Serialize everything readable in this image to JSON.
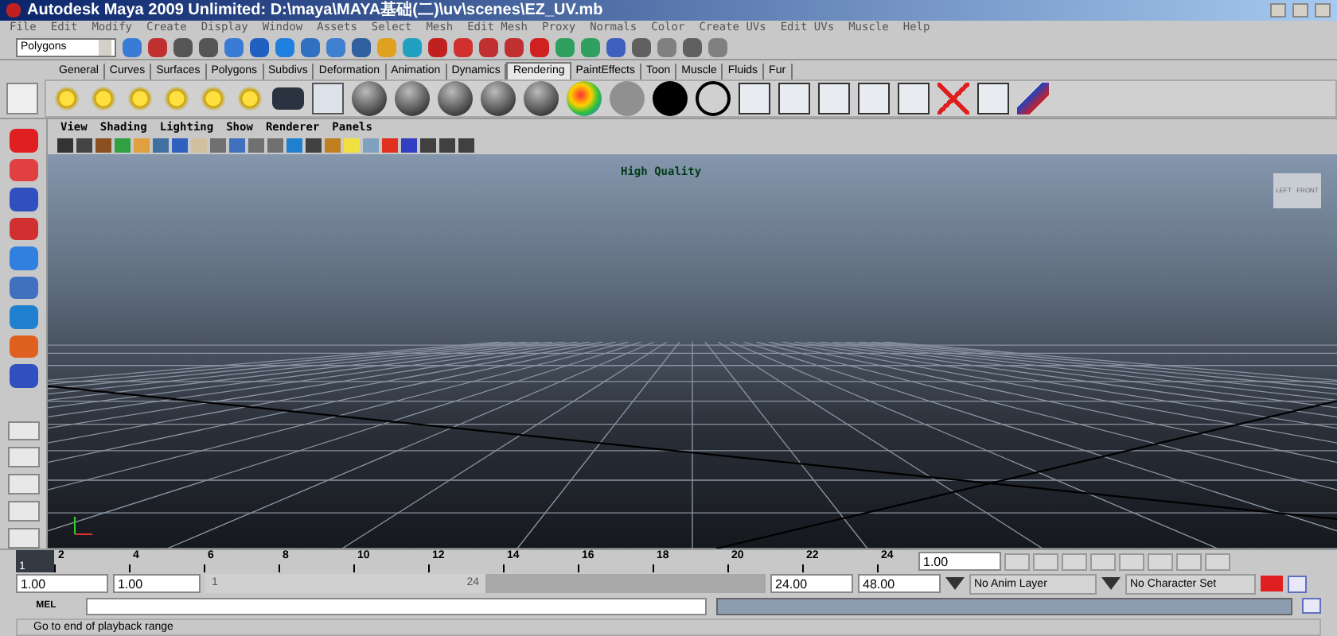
{
  "window": {
    "title": "Autodesk Maya 2009 Unlimited: D:\\maya\\MAYA基础(二)\\uv\\scenes\\EZ_UV.mb"
  },
  "menu": [
    "File",
    "Edit",
    "Modify",
    "Create",
    "Display",
    "Window",
    "Assets",
    "Select",
    "Mesh",
    "Edit Mesh",
    "Proxy",
    "Normals",
    "Color",
    "Create UVs",
    "Edit UVs",
    "Muscle",
    "Help"
  ],
  "status_line": {
    "mode": "Polygons"
  },
  "shelf_tabs": [
    {
      "label": "General",
      "selected": false
    },
    {
      "label": "Curves",
      "selected": false
    },
    {
      "label": "Surfaces",
      "selected": false
    },
    {
      "label": "Polygons",
      "selected": false
    },
    {
      "label": "Subdivs",
      "selected": false
    },
    {
      "label": "Deformation",
      "selected": false
    },
    {
      "label": "Animation",
      "selected": false
    },
    {
      "label": "Dynamics",
      "selected": false
    },
    {
      "label": "Rendering",
      "selected": true
    },
    {
      "label": "PaintEffects",
      "selected": false
    },
    {
      "label": "Toon",
      "selected": false
    },
    {
      "label": "Muscle",
      "selected": false
    },
    {
      "label": "Fluids",
      "selected": false
    },
    {
      "label": "Fur",
      "selected": false
    }
  ],
  "viewport": {
    "menus": [
      "View",
      "Shading",
      "Lighting",
      "Show",
      "Renderer",
      "Panels"
    ],
    "label": "High Quality",
    "view_cube": [
      "LEFT",
      "FRONT"
    ]
  },
  "timeline": {
    "ticks": [
      "2",
      "4",
      "6",
      "8",
      "10",
      "12",
      "14",
      "16",
      "18",
      "20",
      "22",
      "24"
    ],
    "current_frame": "1",
    "level": 0,
    "current_time": "1.00"
  },
  "range": {
    "start": "1.00",
    "min": "1.00",
    "slider_start": "1",
    "slider_end": "24",
    "level": 0.5,
    "max": "24.00",
    "end": "48.00",
    "anim_layer": "No Anim Layer",
    "character_set": "No Character Set"
  },
  "command_line": {
    "label": "MEL"
  },
  "help_line": "Go to end of playback range"
}
